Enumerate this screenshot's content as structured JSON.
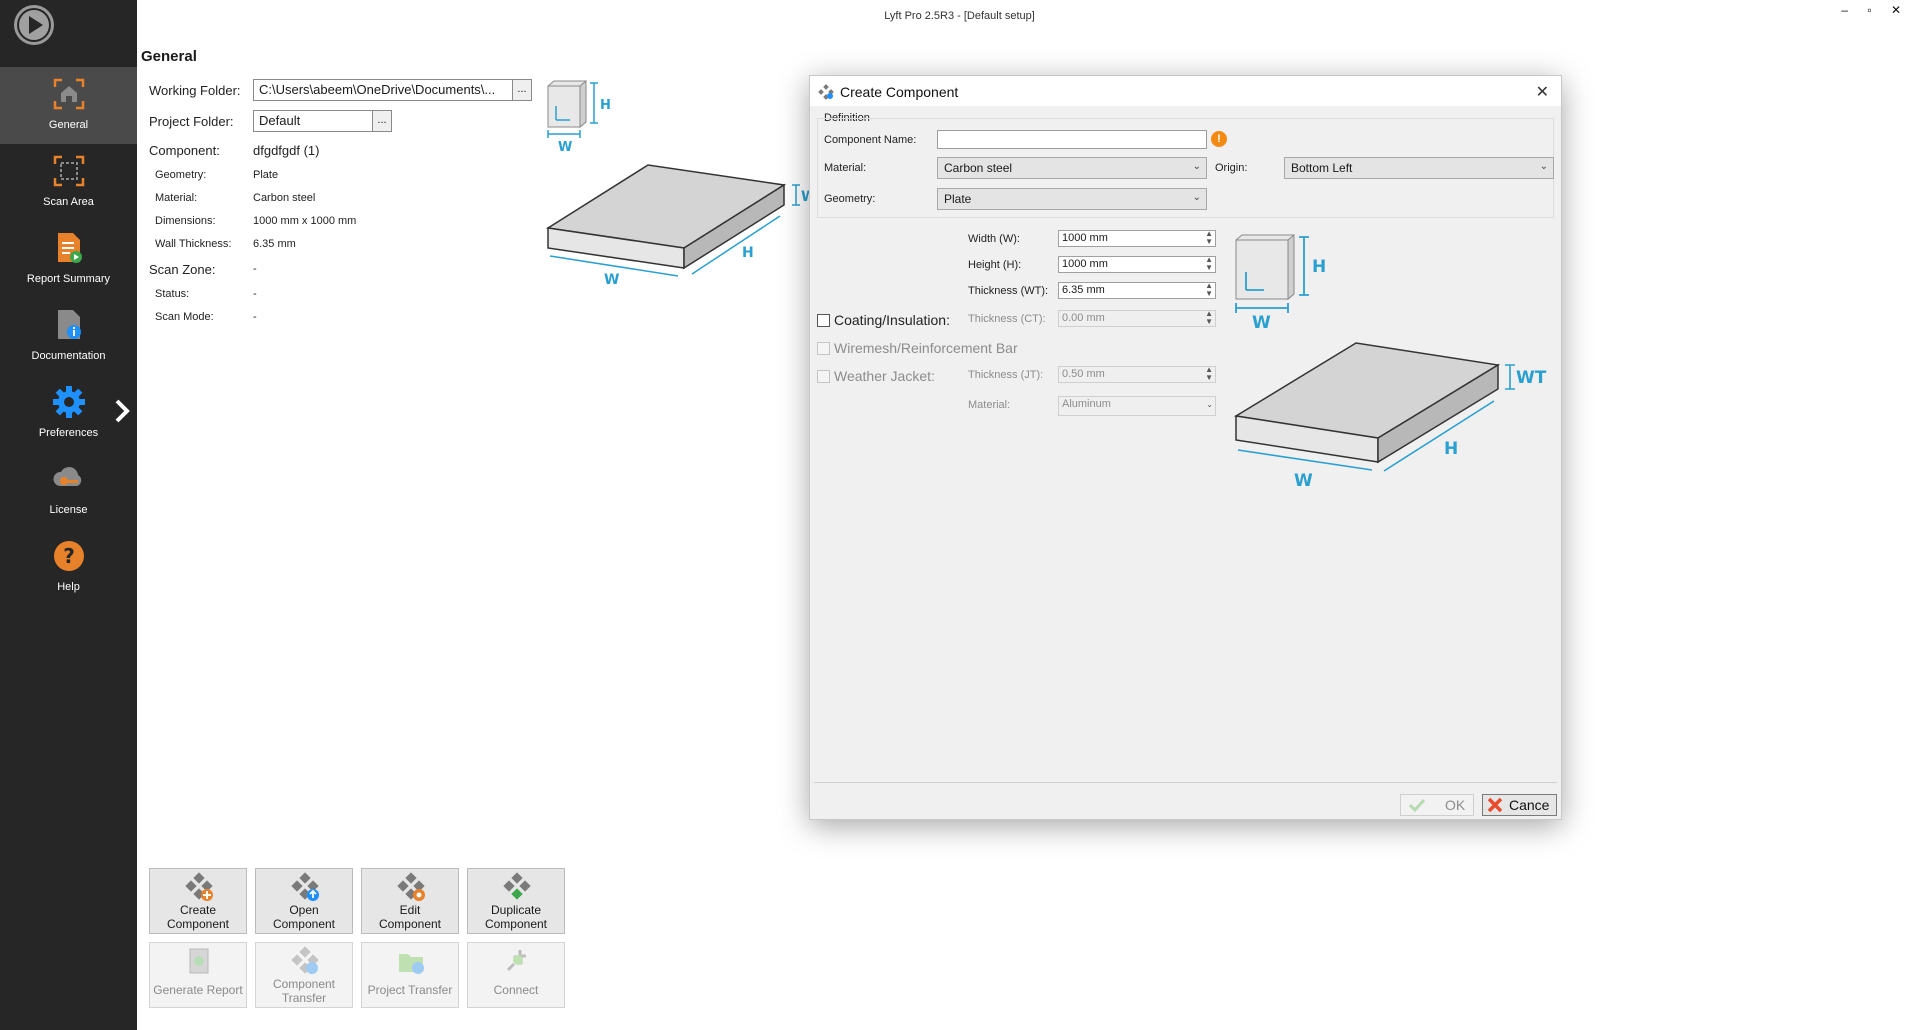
{
  "window": {
    "title": "Lyft Pro 2.5R3 - [Default setup]",
    "controls": [
      "–",
      "▫",
      "✕"
    ]
  },
  "sidebar": {
    "items": [
      {
        "label": "General",
        "icon": "home-scan-icon",
        "active": true
      },
      {
        "label": "Scan Area",
        "icon": "scan-area-icon"
      },
      {
        "label": "Report Summary",
        "icon": "report-summary-icon"
      },
      {
        "label": "Documentation",
        "icon": "documentation-icon"
      },
      {
        "label": "Preferences",
        "icon": "gear-icon"
      },
      {
        "label": "License",
        "icon": "license-key-icon"
      },
      {
        "label": "Help",
        "icon": "help-icon"
      }
    ],
    "colors": {
      "accent": "#e8822a",
      "blue": "#1e90ff"
    }
  },
  "general": {
    "title": "General",
    "working_folder_label": "Working Folder:",
    "working_folder_value": "C:\\Users\\abeem\\OneDrive\\Documents\\...",
    "project_folder_label": "Project Folder:",
    "project_folder_value": "Default",
    "browse": "...",
    "component_label": "Component:",
    "component_value": "dfgdfgdf (1)",
    "geometry_label": "Geometry:",
    "geometry_value": "Plate",
    "material_label": "Material:",
    "material_value": "Carbon steel",
    "dimensions_label": "Dimensions:",
    "dimensions_value": "1000 mm x 1000 mm",
    "wall_thickness_label": "Wall Thickness:",
    "wall_thickness_value": "6.35 mm",
    "scan_zone_label": "Scan Zone:",
    "scan_zone_value": "-",
    "status_label": "Status:",
    "status_value": "-",
    "scan_mode_label": "Scan Mode:",
    "scan_mode_value": "-",
    "diagram": {
      "h": "H",
      "w": "W",
      "wt": "W"
    }
  },
  "actions": {
    "create_1": "Create",
    "create_2": "Component",
    "open_1": "Open",
    "open_2": "Component",
    "edit_1": "Edit",
    "edit_2": "Component",
    "duplicate_1": "Duplicate",
    "duplicate_2": "Component",
    "generate_report": "Generate Report",
    "transfer_1": "Component",
    "transfer_2": "Transfer",
    "project_transfer": "Project Transfer",
    "connect": "Connect"
  },
  "dialog": {
    "title": "Create Component",
    "close": "✕",
    "definition": "Definition",
    "component_name_label": "Component Name:",
    "component_name_value": "",
    "warning": "!",
    "material_label": "Material:",
    "material_value": "Carbon steel",
    "origin_label": "Origin:",
    "origin_value": "Bottom Left",
    "geometry_label": "Geometry:",
    "geometry_value": "Plate",
    "width_label": "Width (W):",
    "width_value": "1000 mm",
    "height_label": "Height (H):",
    "height_value": "1000 mm",
    "thickness_label": "Thickness (WT):",
    "thickness_value": "6.35 mm",
    "coating_label": "Coating/Insulation:",
    "coating_thickness_label": "Thickness (CT):",
    "coating_thickness_value": "0.00 mm",
    "wiremesh_label": "Wiremesh/Reinforcement Bar",
    "jacket_label": "Weather Jacket:",
    "jacket_thickness_label": "Thickness (JT):",
    "jacket_thickness_value": "0.50 mm",
    "jacket_material_label": "Material:",
    "jacket_material_value": "Aluminum",
    "diagram": {
      "h": "H",
      "w": "W",
      "wt": "WT",
      "plate_h": "H",
      "plate_w": "W"
    },
    "ok": "OK",
    "cancel": "Cance"
  }
}
